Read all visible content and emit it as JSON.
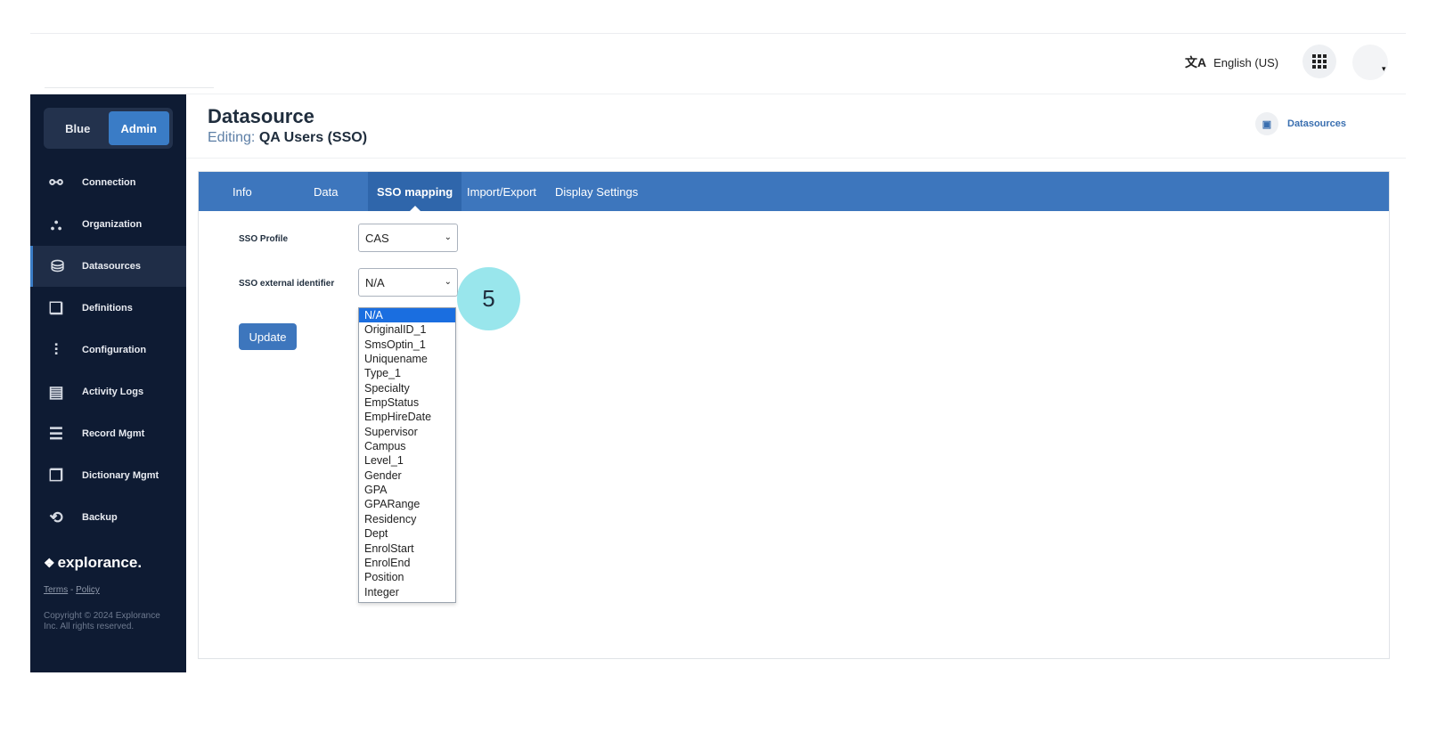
{
  "topbar": {
    "language_glyph": "文A",
    "language_label": "English (US)",
    "apps_icon": "apps-grid-icon",
    "avatar_caret": "▾"
  },
  "sidebar": {
    "portal_toggle": [
      "Blue",
      "Admin"
    ],
    "active_portal": "Admin",
    "items": [
      {
        "label": "Connection",
        "icon": "link-icon",
        "glyph": "⚯"
      },
      {
        "label": "Organization",
        "icon": "org-chart-icon",
        "glyph": "⛬"
      },
      {
        "label": "Datasources",
        "icon": "database-icon",
        "glyph": "⛁"
      },
      {
        "label": "Definitions",
        "icon": "definitions-icon",
        "glyph": "❏"
      },
      {
        "label": "Configuration",
        "icon": "sliders-icon",
        "glyph": "⫶"
      },
      {
        "label": "Activity Logs",
        "icon": "activity-log-icon",
        "glyph": "▤"
      },
      {
        "label": "Record Mgmt",
        "icon": "records-icon",
        "glyph": "☰"
      },
      {
        "label": "Dictionary Mgmt",
        "icon": "dictionary-icon",
        "glyph": "❐"
      },
      {
        "label": "Backup",
        "icon": "backup-icon",
        "glyph": "⟲"
      }
    ],
    "active_item": "Datasources",
    "brand_mark": "❖",
    "brand": "explorance.",
    "terms": "Terms",
    "separator": "-",
    "policy": "Policy",
    "copyright": "Copyright © 2024 Explorance Inc. All rights reserved."
  },
  "header": {
    "title": "Datasource",
    "editing_label": "Editing:",
    "editing_value": "QA Users (SSO)",
    "breadcrumb_icon": "datasource-icon",
    "breadcrumb_glyph": "▣",
    "breadcrumb": "Datasources"
  },
  "tabs": [
    "Info",
    "Data",
    "SSO mapping",
    "Import/Export",
    "Display Settings"
  ],
  "active_tab": "SSO mapping",
  "form": {
    "sso_profile_label": "SSO Profile",
    "sso_profile_value": "CAS",
    "sso_identifier_label": "SSO external identifier",
    "sso_identifier_value": "N/A",
    "chevron": "⌄",
    "update_label": "Update"
  },
  "dropdown": {
    "options": [
      "N/A",
      "OriginalID_1",
      "SmsOptin_1",
      "Uniquename",
      "Type_1",
      "Specialty",
      "EmpStatus",
      "EmpHireDate",
      "Supervisor",
      "Campus",
      "Level_1",
      "Gender",
      "GPA",
      "GPARange",
      "Residency",
      "Dept",
      "EnrolStart",
      "EnrolEnd",
      "Position",
      "Integer"
    ],
    "selected": "N/A"
  },
  "step_badge": "5",
  "colors": {
    "sidebar_bg": "#0e1b33",
    "accent_blue": "#3d76bd",
    "selected_option": "#1a6ee0",
    "badge": "#99e6ec"
  }
}
